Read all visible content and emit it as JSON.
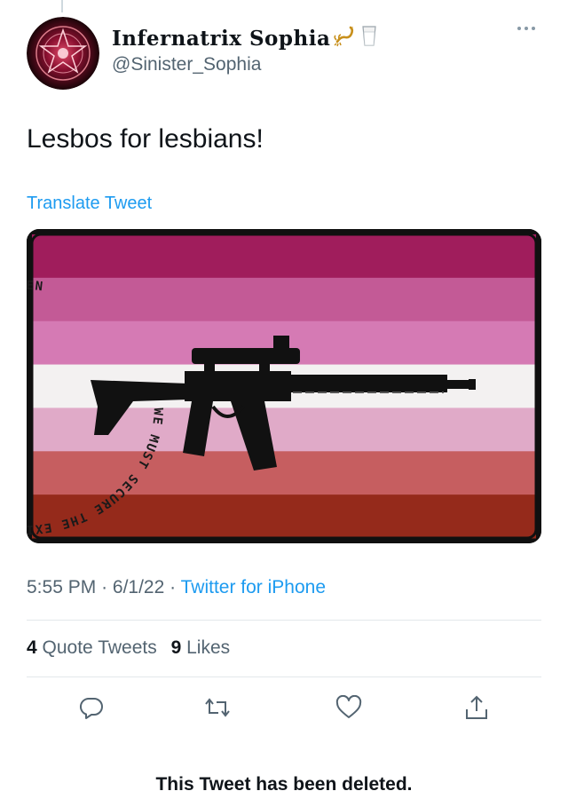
{
  "tweet": {
    "display_name": "Infernatrix Sophia",
    "name_emojis": [
      "scorpion-emoji",
      "milk-glass-emoji"
    ],
    "handle": "@Sinister_Sophia",
    "text": "Lesbos for lesbians!",
    "translate_label": "Translate Tweet",
    "time": "5:55 PM",
    "date": "6/1/22",
    "source": "Twitter for iPhone",
    "separator": "·"
  },
  "media": {
    "stripe_colors": [
      "#a01d5c",
      "#c35a96",
      "#d57ab4",
      "#f3f1f1",
      "#e0aac8",
      "#c65e60",
      "#952a1b"
    ],
    "circle_text": "WE MUST SECURE THE EXISTENCE OF OUR PEOPLE AND A FUTURE FOR GAY WOMEN",
    "icon": "rifle-silhouette"
  },
  "stats": {
    "quote_count": "4",
    "quote_label": "Quote Tweets",
    "like_count": "9",
    "like_label": "Likes"
  },
  "actions": [
    "reply-icon",
    "retweet-icon",
    "like-icon",
    "share-icon"
  ],
  "notice": "This Tweet has been deleted.",
  "colors": {
    "text": "#0f1419",
    "secondary": "#536471",
    "link": "#1d9bf0",
    "divider": "#e3e8eb"
  }
}
